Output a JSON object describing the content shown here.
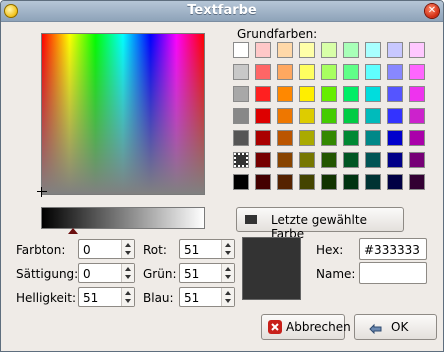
{
  "window": {
    "title": "Textfarbe"
  },
  "palette": {
    "label": "Grundfarben:",
    "colors": [
      [
        "#ffffff",
        "#ffc8c8",
        "#ffd8a8",
        "#ffffa8",
        "#d8ffa8",
        "#a8ffb8",
        "#a8ffff",
        "#c8c8ff"
      ],
      [
        "#c8c8c8",
        "#ff6666",
        "#ffa860",
        "#ffff60",
        "#a8ff60",
        "#60ff88",
        "#60ffff",
        "#8888ff"
      ],
      [
        "#a8a8a8",
        "#ff2020",
        "#ff8800",
        "#ffee00",
        "#66ee00",
        "#00ee66",
        "#00dddd",
        "#5555ff"
      ],
      [
        "#888888",
        "#dd0000",
        "#ee7700",
        "#ddcc00",
        "#44cc00",
        "#00cc44",
        "#00bbbb",
        "#3333ff"
      ],
      [
        "#555555",
        "#aa0000",
        "#bb5500",
        "#aaaa00",
        "#338800",
        "#008833",
        "#008888",
        "#0000cc"
      ],
      [
        "#333333",
        "#770000",
        "#884400",
        "#777700",
        "#225500",
        "#005522",
        "#005555",
        "#000088"
      ],
      [
        "#000000",
        "#440000",
        "#552200",
        "#444400",
        "#113300",
        "#003311",
        "#003333",
        "#000044"
      ]
    ],
    "extra_col": [
      "#ffc8ff",
      "#ff66ff",
      "#ee33ee",
      "#cc22cc",
      "#aa00aa",
      "#770077",
      "#330033"
    ]
  },
  "recent": {
    "label": "Letzte gewählte Farbe",
    "color": "#333333"
  },
  "fields": {
    "farbton": {
      "label": "Farbton:",
      "value": "0"
    },
    "saettigung": {
      "label": "Sättigung:",
      "value": "0"
    },
    "helligkeit": {
      "label": "Helligkeit:",
      "value": "51"
    },
    "rot": {
      "label": "Rot:",
      "value": "51"
    },
    "gruen": {
      "label": "Grün:",
      "value": "51"
    },
    "blau": {
      "label": "Blau:",
      "value": "51"
    },
    "hex": {
      "label": "Hex:",
      "value": "#333333"
    },
    "name": {
      "label": "Name:",
      "value": ""
    }
  },
  "preview": {
    "color": "#333333"
  },
  "buttons": {
    "cancel": "Abbrechen",
    "ok": "OK"
  },
  "icons": {
    "app": "app-icon",
    "close": "close-icon",
    "cancel": "cancel-icon",
    "ok": "ok-icon"
  },
  "accent": {
    "titlebar": "#8ea3b9",
    "selected_swatch": "#333333"
  }
}
